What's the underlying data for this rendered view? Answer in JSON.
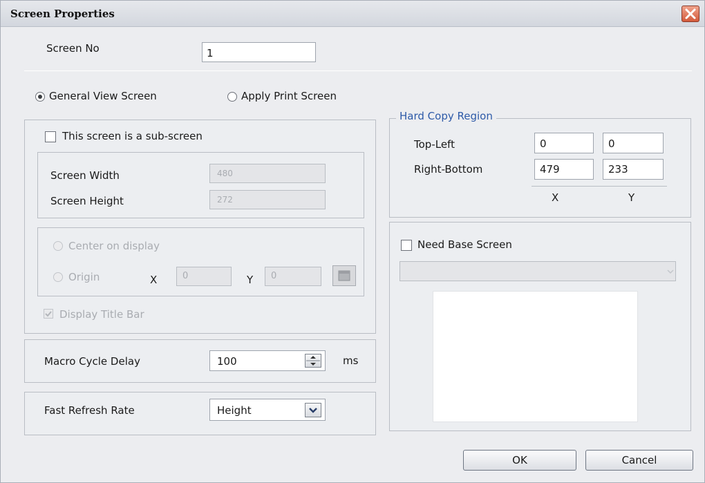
{
  "window": {
    "title": "Screen Properties"
  },
  "screen_no": {
    "label": "Screen No",
    "value": "1"
  },
  "screen_type": {
    "general_label": "General View Screen",
    "print_label": "Apply Print Screen",
    "selected": "General View Screen"
  },
  "sub_screen": {
    "checkbox_label": "This screen is a sub-screen",
    "checked": false,
    "width_label": "Screen Width",
    "width_value": "480",
    "height_label": "Screen Height",
    "height_value": "272",
    "center_label": "Center on display",
    "origin_label": "Origin",
    "x_label": "X",
    "x_value": "0",
    "y_label": "Y",
    "y_value": "0",
    "title_bar_label": "Display Title Bar"
  },
  "macro": {
    "label": "Macro Cycle Delay",
    "value": "100",
    "unit": "ms"
  },
  "refresh": {
    "label": "Fast Refresh Rate",
    "value": "Height"
  },
  "hard_copy": {
    "legend": "Hard Copy Region",
    "top_left_label": "Top-Left",
    "top_left_x": "0",
    "top_left_y": "0",
    "right_bottom_label": "Right-Bottom",
    "right_bottom_x": "479",
    "right_bottom_y": "233",
    "x_caption": "X",
    "y_caption": "Y"
  },
  "base_screen": {
    "checkbox_label": "Need Base Screen",
    "checked": false
  },
  "buttons": {
    "ok": "OK",
    "cancel": "Cancel"
  },
  "colors": {
    "accent_text": "#2d5aa8",
    "close_button": "#d35a3b"
  },
  "icons": {
    "close": "close-x-icon",
    "spinner": "spin-up-down-icon",
    "dropdown": "chevron-down-icon",
    "browse": "screen-select-icon"
  }
}
